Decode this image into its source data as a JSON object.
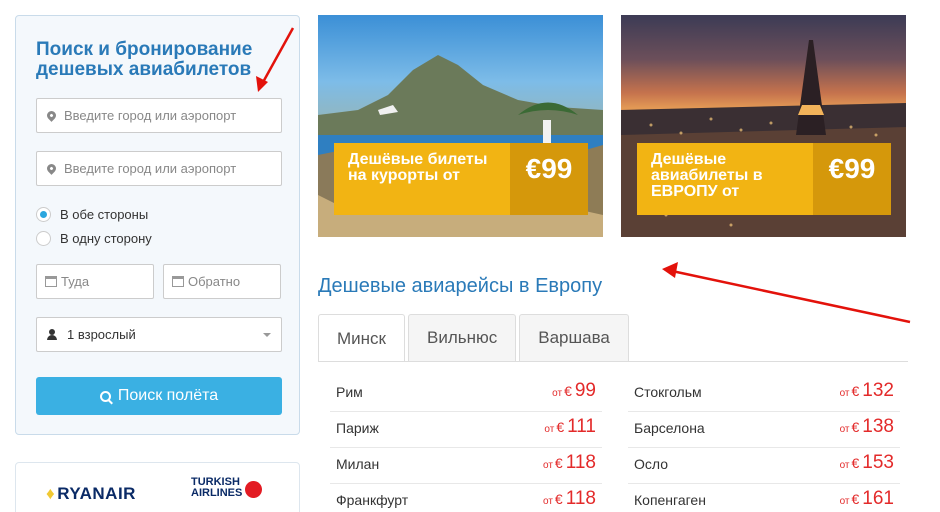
{
  "search": {
    "title": "Поиск и бронирование дешевых авиабилетов",
    "from_placeholder": "Введите город или аэропорт",
    "to_placeholder": "Введите город или аэропорт",
    "trip_type": {
      "round_trip": "В обе стороны",
      "one_way": "В одну сторону",
      "selected": "round_trip"
    },
    "date_from_placeholder": "Туда",
    "date_back_placeholder": "Обратно",
    "passengers": "1 взрослый",
    "submit_label": "Поиск полёта"
  },
  "airlines": {
    "ryanair": "RYANAIR",
    "turkish_line1": "TURKISH",
    "turkish_line2": "AIRLINES"
  },
  "promos": [
    {
      "text": "Дешёвые билеты на курорты от",
      "price": "€99"
    },
    {
      "text": "Дешёвые авиабилеты в ЕВРОПУ от",
      "price": "€99"
    }
  ],
  "section_title": "Дешевые авиарейсы в Европу",
  "tabs": [
    {
      "label": "Минск",
      "active": true
    },
    {
      "label": "Вильнюс",
      "active": false
    },
    {
      "label": "Варшава",
      "active": false
    }
  ],
  "prices": {
    "prefix": "от",
    "currency": "€",
    "left": [
      {
        "city": "Рим",
        "value": "99"
      },
      {
        "city": "Париж",
        "value": "111"
      },
      {
        "city": "Милан",
        "value": "118"
      },
      {
        "city": "Франкфурт",
        "value": "118"
      }
    ],
    "right": [
      {
        "city": "Стокгольм",
        "value": "132"
      },
      {
        "city": "Барселона",
        "value": "138"
      },
      {
        "city": "Осло",
        "value": "153"
      },
      {
        "city": "Копенгаген",
        "value": "161"
      }
    ]
  },
  "colors": {
    "accent": "#2a7ab8",
    "button": "#3ab0e3",
    "promo": "#f2b413",
    "price": "#e32a2a",
    "annotation_arrow": "#e3120b"
  }
}
